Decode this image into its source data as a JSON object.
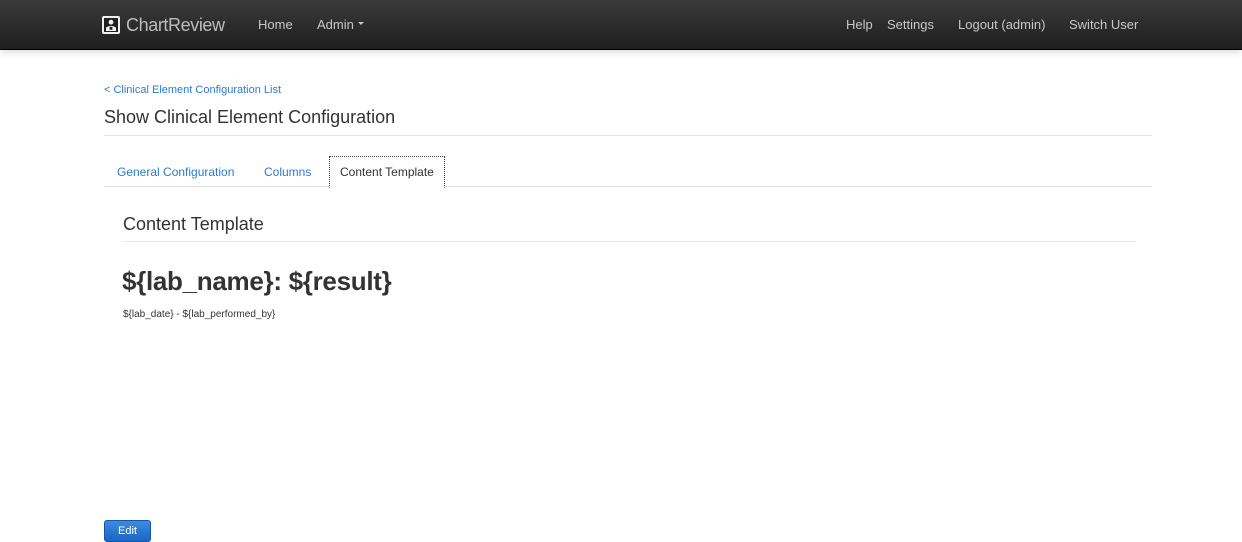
{
  "navbar": {
    "brand": "ChartReview",
    "home_label": "Home",
    "admin_label": "Admin",
    "help_label": "Help",
    "settings_label": "Settings",
    "logout_label": "Logout (admin)",
    "switch_user_label": "Switch User"
  },
  "page": {
    "back_link": "< Clinical Element Configuration List",
    "title": "Show Clinical Element Configuration"
  },
  "tabs": [
    {
      "label": "General Configuration",
      "active": false
    },
    {
      "label": "Columns",
      "active": false
    },
    {
      "label": "Content Template",
      "active": true
    }
  ],
  "content": {
    "section_title": "Content Template",
    "template_heading": "${lab_name}: ${result}",
    "template_sub": "${lab_date} - ${lab_performed_by}"
  },
  "actions": {
    "edit_label": "Edit"
  },
  "colors": {
    "link": "#2a7bd0",
    "primary_button": "#1966c4",
    "navbar": "#1f1f1f"
  }
}
